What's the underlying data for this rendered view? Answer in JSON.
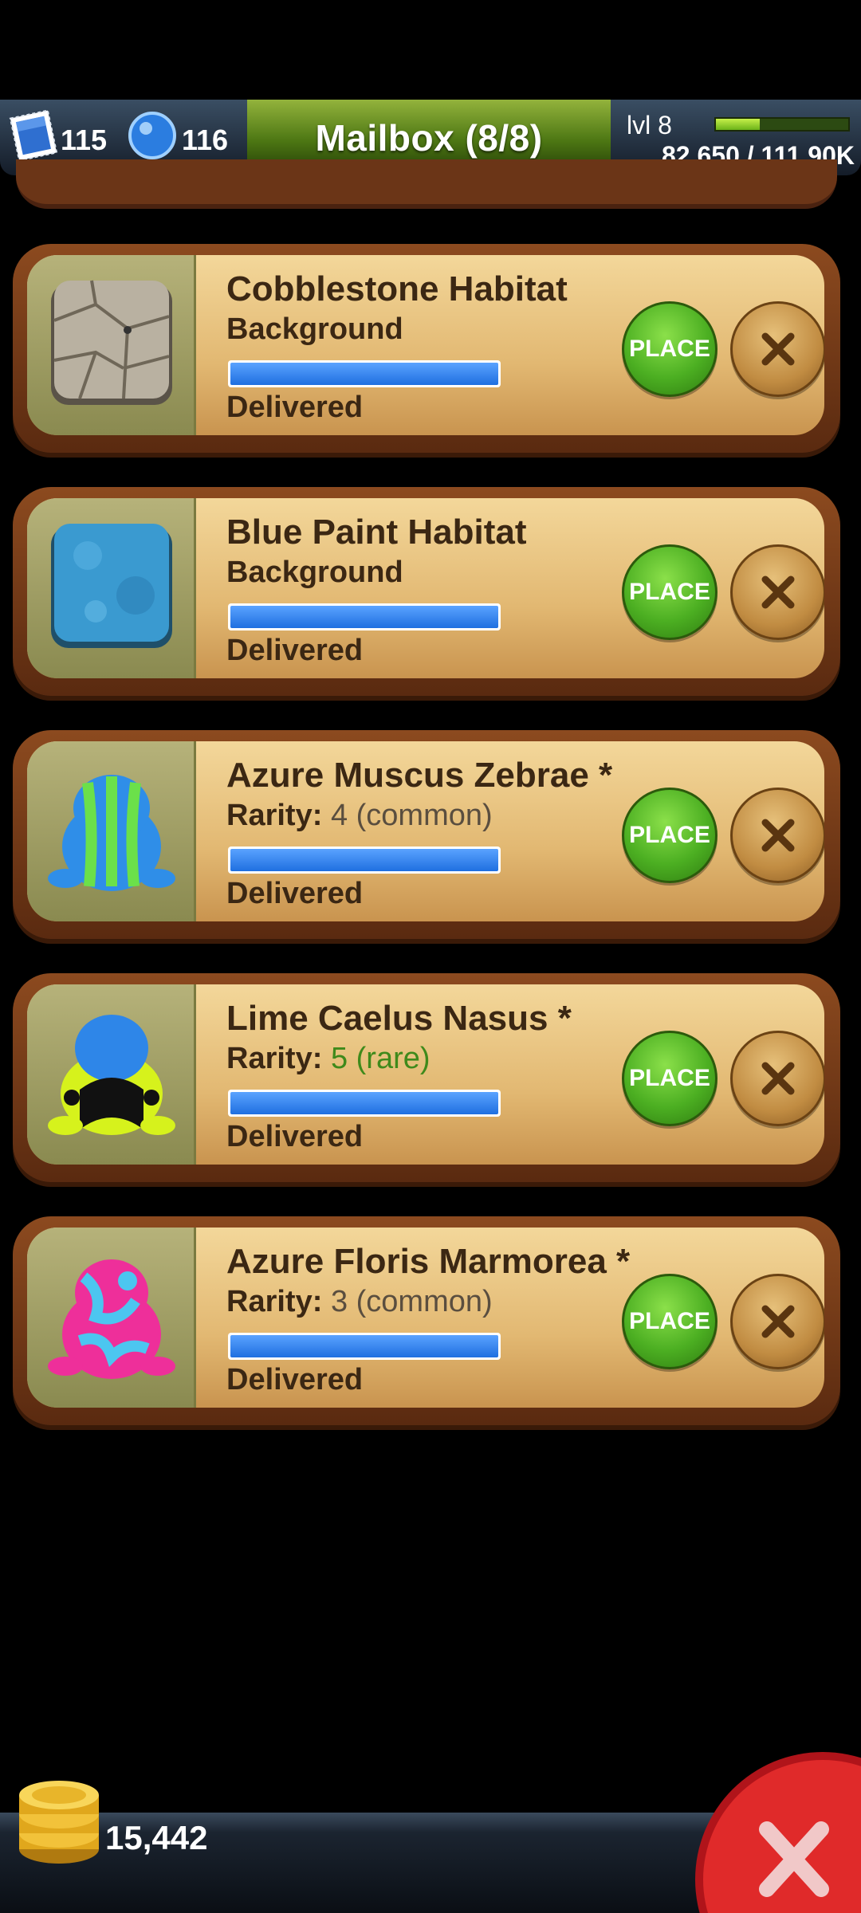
{
  "header": {
    "title": "Mailbox (8/8)",
    "stamps": "115",
    "gems": "116",
    "level": "lvl 8",
    "xp_text": "82,650 / 111.90K",
    "xp_progress": 0.33
  },
  "mail_items": [
    {
      "name": "Cobblestone Habitat",
      "sub_label": "Background",
      "status": "Delivered",
      "place_label": "PLACE",
      "thumb_icon": "cobblestone-tile-icon"
    },
    {
      "name": "Blue Paint Habitat",
      "sub_label": "Background",
      "status": "Delivered",
      "place_label": "PLACE",
      "thumb_icon": "blue-paint-tile-icon"
    },
    {
      "name": "Azure Muscus Zebrae *",
      "sub_label": "Rarity:",
      "rarity_value": "4 (common)",
      "rarity_color": "#5a4e3f",
      "status": "Delivered",
      "place_label": "PLACE",
      "thumb_icon": "frog-icon"
    },
    {
      "name": "Lime Caelus Nasus *",
      "sub_label": "Rarity:",
      "rarity_value": "5 (rare)",
      "rarity_color": "#3f8a1b",
      "status": "Delivered",
      "place_label": "PLACE",
      "thumb_icon": "frog-icon"
    },
    {
      "name": "Azure Floris Marmorea *",
      "sub_label": "Rarity:",
      "rarity_value": "3 (common)",
      "rarity_color": "#5a4e3f",
      "status": "Delivered",
      "place_label": "PLACE",
      "thumb_icon": "frog-icon"
    }
  ],
  "footer": {
    "coins": "15,442"
  },
  "colors": {
    "place_button": "#4caf22",
    "progress_fill": "#1f6fe0",
    "card_frame": "#8c4a1f"
  }
}
